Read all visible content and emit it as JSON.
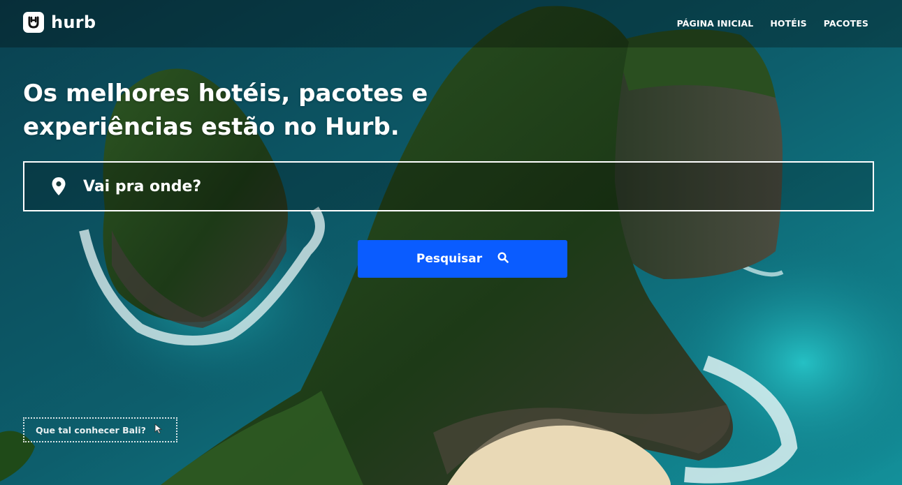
{
  "brand": {
    "name": "hurb",
    "logo_icon": "hurb-logo-icon"
  },
  "nav": {
    "items": [
      {
        "label": "PÁGINA INICIAL"
      },
      {
        "label": "HOTÉIS"
      },
      {
        "label": "PACOTES"
      }
    ]
  },
  "hero": {
    "headline_line1": "Os melhores hotéis, pacotes e",
    "headline_line2": "experiências estão no Hurb.",
    "background": "aerial photo of sea cliffs and turquoise ocean"
  },
  "search": {
    "placeholder": "Vai pra onde?",
    "icon": "map-pin-icon",
    "button_label": "Pesquisar",
    "button_icon": "search-icon"
  },
  "suggestion": {
    "label": "Que tal conhecer Bali?",
    "icon": "pointer-cursor-icon"
  },
  "colors": {
    "accent": "#0a5cff",
    "ocean": "#0f6f7f",
    "cliff": "#24451c"
  }
}
